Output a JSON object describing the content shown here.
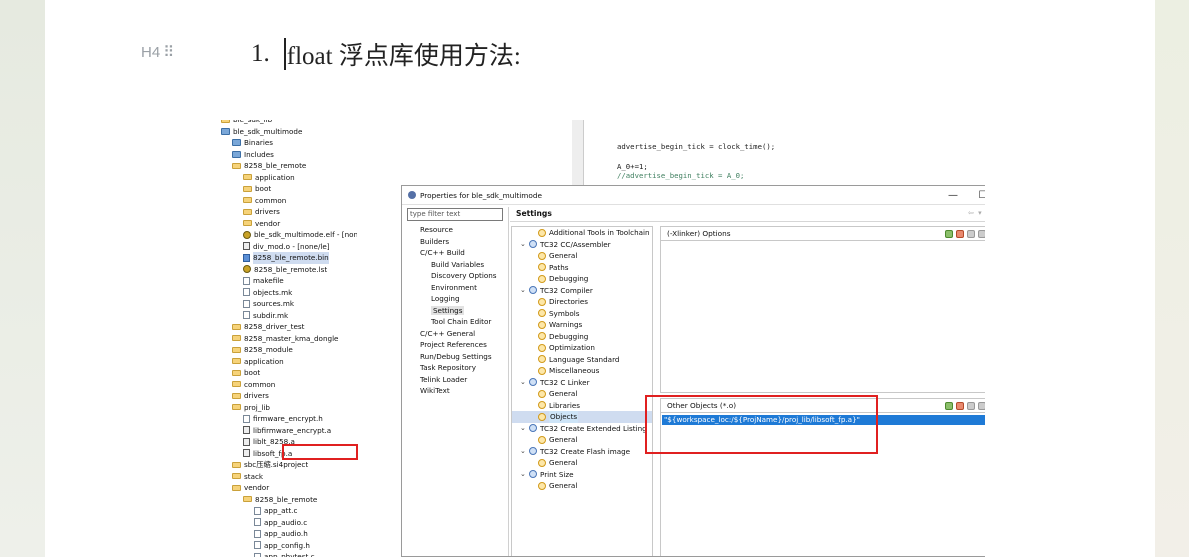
{
  "editor": {
    "heading_marker": "H4",
    "heading_number": "1.",
    "heading_text": "float 浮点库使用方法:"
  },
  "project_tree": {
    "items": [
      {
        "label": "ble_sdk_lib",
        "icon": "folder",
        "indent": 0
      },
      {
        "label": "ble_sdk_multimode",
        "icon": "project-icon",
        "indent": 0
      },
      {
        "label": "Binaries",
        "icon": "binaries-icon",
        "indent": 1
      },
      {
        "label": "Includes",
        "icon": "includes-icon",
        "indent": 1
      },
      {
        "label": "8258_ble_remote",
        "icon": "folder",
        "indent": 1
      },
      {
        "label": "application",
        "icon": "folder",
        "indent": 2
      },
      {
        "label": "boot",
        "icon": "folder",
        "indent": 2
      },
      {
        "label": "common",
        "icon": "folder",
        "indent": 2
      },
      {
        "label": "drivers",
        "icon": "folder",
        "indent": 2
      },
      {
        "label": "vendor",
        "icon": "folder",
        "indent": 2
      },
      {
        "label": "ble_sdk_multimode.elf - [none",
        "icon": "gear-icon",
        "indent": 2
      },
      {
        "label": "div_mod.o - [none/le]",
        "icon": "binary-file",
        "indent": 2
      },
      {
        "label": "8258_ble_remote.bin",
        "icon": "bin-file",
        "indent": 2,
        "selected": true
      },
      {
        "label": "8258_ble_remote.lst",
        "icon": "gear-icon",
        "indent": 2
      },
      {
        "label": "makefile",
        "icon": "file",
        "indent": 2
      },
      {
        "label": "objects.mk",
        "icon": "file",
        "indent": 2
      },
      {
        "label": "sources.mk",
        "icon": "file",
        "indent": 2
      },
      {
        "label": "subdir.mk",
        "icon": "file",
        "indent": 2
      },
      {
        "label": "8258_driver_test",
        "icon": "folder",
        "indent": 1
      },
      {
        "label": "8258_master_kma_dongle",
        "icon": "folder",
        "indent": 1
      },
      {
        "label": "8258_module",
        "icon": "folder",
        "indent": 1
      },
      {
        "label": "application",
        "icon": "folder",
        "indent": 1
      },
      {
        "label": "boot",
        "icon": "folder",
        "indent": 1
      },
      {
        "label": "common",
        "icon": "folder",
        "indent": 1
      },
      {
        "label": "drivers",
        "icon": "folder",
        "indent": 1
      },
      {
        "label": "proj_lib",
        "icon": "folder",
        "indent": 1
      },
      {
        "label": "firmware_encrypt.h",
        "icon": "header-file",
        "indent": 2
      },
      {
        "label": "libfirmware_encrypt.a",
        "icon": "lib-file",
        "indent": 2
      },
      {
        "label": "liblt_8258.a",
        "icon": "lib-file",
        "indent": 2
      },
      {
        "label": "libsoft_fp.a",
        "icon": "lib-file",
        "indent": 2
      },
      {
        "label": "sbc压缩.si4project",
        "icon": "folder",
        "indent": 1
      },
      {
        "label": "stack",
        "icon": "folder",
        "indent": 1
      },
      {
        "label": "vendor",
        "icon": "folder",
        "indent": 1
      },
      {
        "label": "8258_ble_remote",
        "icon": "folder",
        "indent": 2
      },
      {
        "label": "app_att.c",
        "icon": "c-file",
        "indent": 3
      },
      {
        "label": "app_audio.c",
        "icon": "c-file",
        "indent": 3
      },
      {
        "label": "app_audio.h",
        "icon": "header-file",
        "indent": 3
      },
      {
        "label": "app_config.h",
        "icon": "header-file",
        "indent": 3
      },
      {
        "label": "app_phytest.c",
        "icon": "c-file",
        "indent": 3
      }
    ]
  },
  "code": {
    "lines": [
      "advertise_begin_tick = clock_time();",
      "A_0+=1;",
      "//advertise_begin_tick = A_0;"
    ]
  },
  "dialog": {
    "title": "Properties for ble_sdk_multimode",
    "minimize": "—",
    "maximize": "☐",
    "close": "✕",
    "filter_placeholder": "type filter text",
    "settings_title": "Settings",
    "nav_buttons": "⇦ ▾ ⇨ ▾ ▾",
    "nav_items": [
      {
        "label": "Resource",
        "level": 0
      },
      {
        "label": "Builders",
        "level": 0
      },
      {
        "label": "C/C++ Build",
        "level": 0
      },
      {
        "label": "Build Variables",
        "level": 1
      },
      {
        "label": "Discovery Options",
        "level": 1
      },
      {
        "label": "Environment",
        "level": 1
      },
      {
        "label": "Logging",
        "level": 1
      },
      {
        "label": "Settings",
        "level": 1,
        "selected": true
      },
      {
        "label": "Tool Chain Editor",
        "level": 1
      },
      {
        "label": "C/C++ General",
        "level": 0
      },
      {
        "label": "Project References",
        "level": 0
      },
      {
        "label": "Run/Debug Settings",
        "level": 0
      },
      {
        "label": "Task Repository",
        "level": 0
      },
      {
        "label": "Telink Loader",
        "level": 0
      },
      {
        "label": "WikiText",
        "level": 0
      }
    ],
    "tool_items": [
      {
        "label": "Additional Tools in Toolchain",
        "type": "leaf",
        "level": 1
      },
      {
        "label": "TC32 CC/Assembler",
        "type": "group",
        "level": 0
      },
      {
        "label": "General",
        "type": "leaf",
        "level": 1
      },
      {
        "label": "Paths",
        "type": "leaf",
        "level": 1
      },
      {
        "label": "Debugging",
        "type": "leaf",
        "level": 1
      },
      {
        "label": "TC32 Compiler",
        "type": "group",
        "level": 0
      },
      {
        "label": "Directories",
        "type": "leaf",
        "level": 1
      },
      {
        "label": "Symbols",
        "type": "leaf",
        "level": 1
      },
      {
        "label": "Warnings",
        "type": "leaf",
        "level": 1
      },
      {
        "label": "Debugging",
        "type": "leaf",
        "level": 1
      },
      {
        "label": "Optimization",
        "type": "leaf",
        "level": 1
      },
      {
        "label": "Language Standard",
        "type": "leaf",
        "level": 1
      },
      {
        "label": "Miscellaneous",
        "type": "leaf",
        "level": 1
      },
      {
        "label": "TC32 C Linker",
        "type": "group",
        "level": 0
      },
      {
        "label": "General",
        "type": "leaf",
        "level": 1
      },
      {
        "label": "Libraries",
        "type": "leaf",
        "level": 1
      },
      {
        "label": "Objects",
        "type": "leaf",
        "level": 1,
        "selected": true
      },
      {
        "label": "TC32 Create Extended Listing",
        "type": "group",
        "level": 0
      },
      {
        "label": "General",
        "type": "leaf",
        "level": 1
      },
      {
        "label": "TC32 Create Flash image",
        "type": "group",
        "level": 0
      },
      {
        "label": "General",
        "type": "leaf",
        "level": 1
      },
      {
        "label": "Print Size",
        "type": "group",
        "level": 0
      },
      {
        "label": "General",
        "type": "leaf",
        "level": 1
      }
    ],
    "options_panel_title": "(-Xlinker) Options",
    "objects_panel_title": "Other Objects (*.o)",
    "objects_value": "\"${workspace_loc:/${ProjName}/proj_lib/libsoft_fp.a}\""
  },
  "colors": {
    "highlight_red": "#e02020",
    "selection_blue": "#1e7ad6"
  }
}
